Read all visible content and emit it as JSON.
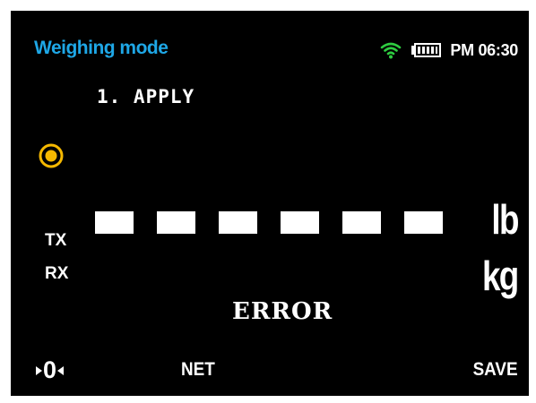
{
  "header": {
    "mode_title": "Weighing mode",
    "clock": "PM 06:30",
    "wifi_icon": "wifi-icon",
    "battery_icon": "battery-icon"
  },
  "menu": {
    "item_label": "1. APPLY"
  },
  "indicator": {
    "icon": "radio-indicator-icon"
  },
  "comm": {
    "tx_label": "TX",
    "rx_label": "RX"
  },
  "display": {
    "segment_count": 6,
    "units": {
      "lb": "lb",
      "kg": "kg"
    },
    "status_text": "ERROR"
  },
  "footer": {
    "zero_label": "0",
    "net_label": "NET",
    "save_label": "SAVE"
  },
  "colors": {
    "background": "#000000",
    "title": "#1ea7e6",
    "wifi": "#2ecc40",
    "indicator": "#f5b800",
    "text": "#ffffff"
  }
}
